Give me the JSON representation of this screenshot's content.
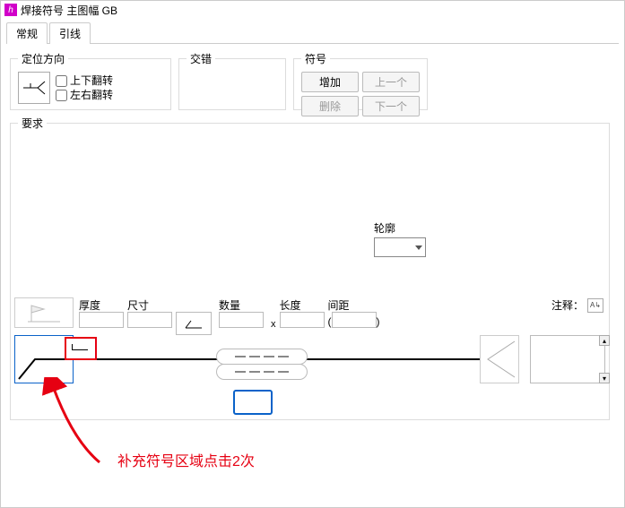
{
  "window": {
    "title": "焊接符号 主图幅 GB",
    "app_icon_letter": "h"
  },
  "tabs": {
    "general": "常规",
    "leader": "引线"
  },
  "orient": {
    "legend": "定位方向",
    "flip_v": "上下翻转",
    "flip_h": "左右翻转"
  },
  "stagger": {
    "legend": "交错"
  },
  "symbol": {
    "legend": "符号",
    "add": "增加",
    "prev": "上一个",
    "del": "删除",
    "next": "下一个"
  },
  "req": {
    "legend": "要求",
    "contour_label": "轮廓",
    "thickness": "厚度",
    "size": "尺寸",
    "count": "数量",
    "length": "长度",
    "pitch": "间距",
    "note_label": "注释：",
    "x": "x",
    "lp": "(",
    "rp": ")"
  },
  "annotation": {
    "text": "补充符号区域点击2次"
  }
}
